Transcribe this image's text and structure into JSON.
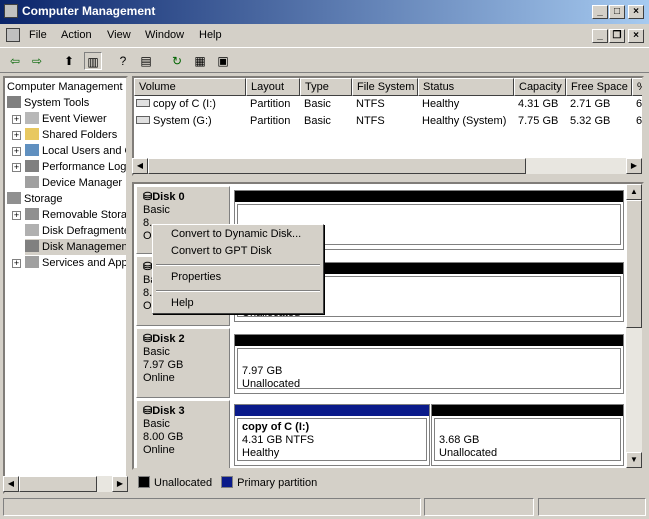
{
  "window": {
    "title": "Computer Management"
  },
  "menu": [
    "File",
    "Action",
    "View",
    "Window",
    "Help"
  ],
  "toolbar": {
    "icons": [
      "back-icon",
      "forward-icon",
      "up-icon",
      "show-hide-tree-icon",
      "help-icon",
      "export-icon",
      "refresh-icon",
      "properties-icon",
      "help-topic-icon"
    ]
  },
  "tree": {
    "root": "Computer Management (",
    "system_tools": "System Tools",
    "event_viewer": "Event Viewer",
    "shared_folders": "Shared Folders",
    "local_users": "Local Users and G",
    "performance": "Performance Log",
    "device_manager": "Device Manager",
    "storage": "Storage",
    "removable": "Removable Stora",
    "defrag": "Disk Defragmenter",
    "disk_mgmt": "Disk Managemen",
    "services": "Services and Applicat"
  },
  "list": {
    "headers": [
      "Volume",
      "Layout",
      "Type",
      "File System",
      "Status",
      "Capacity",
      "Free Space",
      "%"
    ],
    "rows": [
      {
        "volume": "copy of C (I:)",
        "layout": "Partition",
        "type": "Basic",
        "fs": "NTFS",
        "status": "Healthy",
        "capacity": "4.31 GB",
        "free": "2.71 GB",
        "pct": "6"
      },
      {
        "volume": "System (G:)",
        "layout": "Partition",
        "type": "Basic",
        "fs": "NTFS",
        "status": "Healthy (System)",
        "capacity": "7.75 GB",
        "free": "5.32 GB",
        "pct": "6"
      }
    ]
  },
  "disks": {
    "d0": {
      "name": "Disk 0",
      "type": "Basic",
      "size": "8.",
      "state": "Onl"
    },
    "d1": {
      "type": "Ba",
      "size": "8.",
      "state": "On",
      "part_text": "Unallocated"
    },
    "d2": {
      "name": "Disk 2",
      "type": "Basic",
      "size": "7.97 GB",
      "state": "Online",
      "part_size": "7.97 GB",
      "part_status": "Unallocated"
    },
    "d3": {
      "name": "Disk 3",
      "type": "Basic",
      "size": "8.00 GB",
      "state": "Online",
      "p1_name": "copy of C  (I:)",
      "p1_size": "4.31 GB NTFS",
      "p1_status": "Healthy",
      "p2_size": "3.68 GB",
      "p2_status": "Unallocated"
    }
  },
  "legend": {
    "unallocated": "Unallocated",
    "primary": "Primary partition",
    "colors": {
      "unallocated": "#000000",
      "primary": "#0a1a8a"
    }
  },
  "context_menu": {
    "convert_dynamic": "Convert to Dynamic Disk...",
    "convert_gpt": "Convert to GPT Disk",
    "properties": "Properties",
    "help": "Help"
  }
}
